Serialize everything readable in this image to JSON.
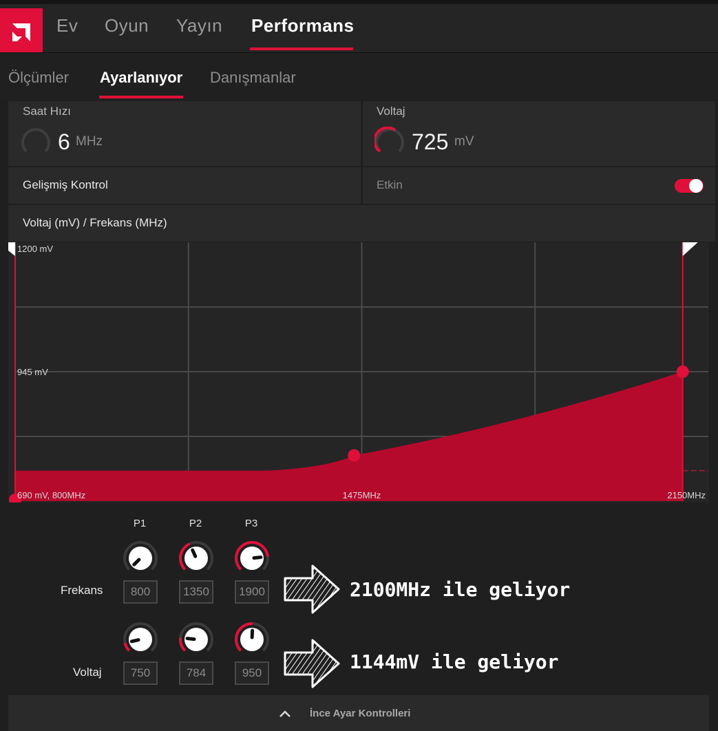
{
  "nav": {
    "tabs": [
      "Ev",
      "Oyun",
      "Yayın",
      "Performans"
    ],
    "active": "Performans"
  },
  "subnav": {
    "tabs": [
      "Ölçümler",
      "Ayarlanıyor",
      "Danışmanlar"
    ],
    "active": "Ayarlanıyor"
  },
  "clock": {
    "label": "Saat Hızı",
    "value": "6",
    "unit": "MHz"
  },
  "voltage": {
    "label": "Voltaj",
    "value": "725",
    "unit": "mV"
  },
  "advanced": {
    "label": "Gelişmiş Kontrol",
    "state_label": "Etkin",
    "enabled": true
  },
  "curve": {
    "title": "Voltaj (mV) / Frekans (MHz)"
  },
  "chart_data": {
    "type": "area",
    "y_tick_labels": [
      "1200 mV",
      "945 mV",
      "690 mV, 800MHz"
    ],
    "x_tick_labels": [
      "1475MHz",
      "2150MHz"
    ],
    "xlim": [
      800,
      2150
    ],
    "ylim": [
      690,
      1200
    ],
    "points": [
      {
        "x": 800,
        "y": 690
      },
      {
        "x": 1460,
        "y": 780
      },
      {
        "x": 2100,
        "y": 945
      }
    ],
    "flat_voltage": 750,
    "flat_until_x": 1290,
    "max_freq_marker": 2100,
    "colors": {
      "fill": "#b50a2c",
      "accent": "#e0103a",
      "grid": "#4a4a4a"
    }
  },
  "controls": {
    "columns": [
      "P1",
      "P2",
      "P3"
    ],
    "frequency": {
      "label": "Frekans",
      "values": [
        "800",
        "1350",
        "1900"
      ],
      "levels": [
        0.0,
        0.41,
        0.81
      ]
    },
    "voltage": {
      "label": "Voltaj",
      "values": [
        "750",
        "784",
        "950"
      ],
      "levels": [
        0.12,
        0.19,
        0.51
      ]
    }
  },
  "annotations": {
    "frequency_note": "2100MHz ile geliyor",
    "voltage_note": "1144mV ile geliyor"
  },
  "footer": {
    "label": "İnce Ayar Kontrolleri"
  },
  "icons": {
    "logo": "amd-logo-icon",
    "chevron": "chevron-up-icon",
    "arrow": "right-arrow-icon"
  }
}
